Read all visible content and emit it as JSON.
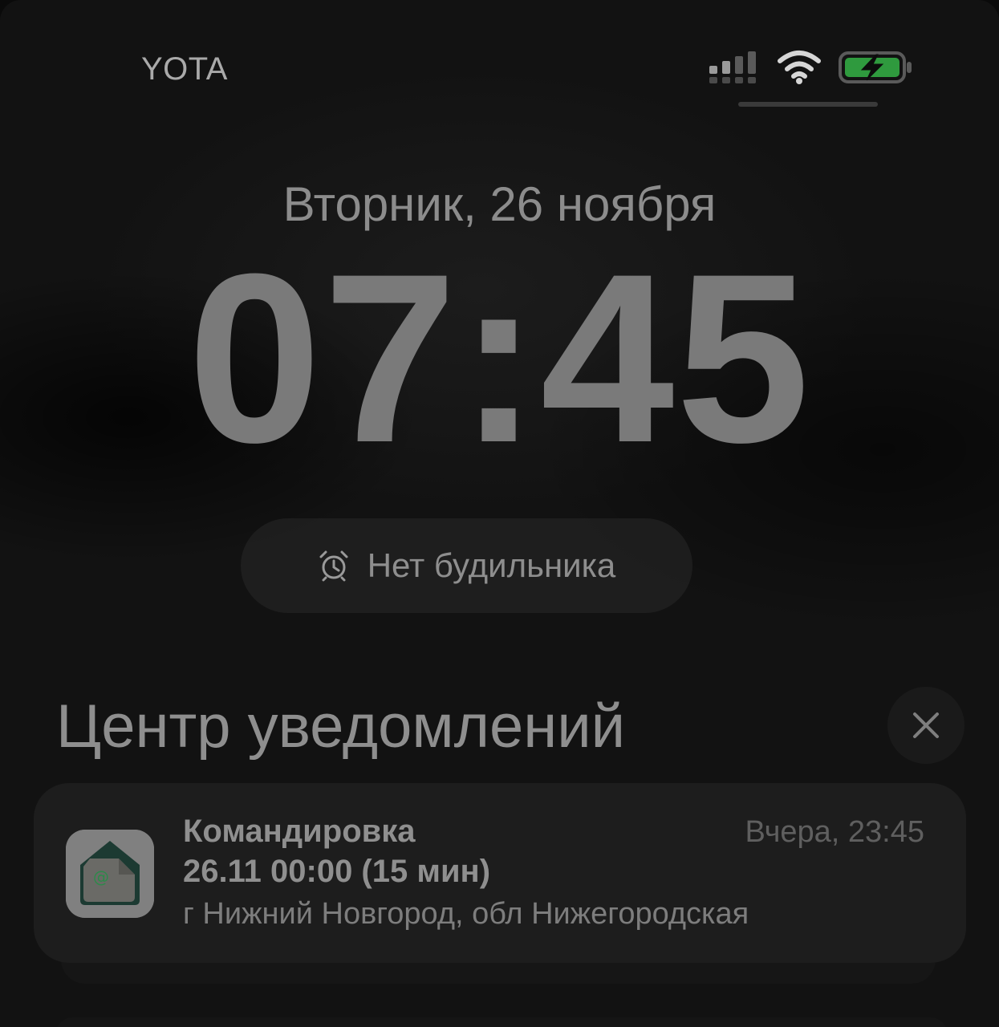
{
  "status_bar": {
    "carrier": "YOTA",
    "icons": [
      "cellular-signal-icon",
      "wifi-icon",
      "battery-charging-icon"
    ],
    "battery_color": "#2f9a3e"
  },
  "lock_screen": {
    "date": "Вторник, 26 ноября",
    "time": "07:45",
    "alarm": {
      "icon": "alarm-clock-icon",
      "label": "Нет будильника"
    }
  },
  "notification_center": {
    "title": "Центр уведомлений",
    "close_icon": "close-icon",
    "notifications": [
      {
        "app_icon": "mail-app-icon",
        "title": "Командировка",
        "time": "Вчера, 23:45",
        "line1": "26.11 00:00 (15 мин)",
        "line2": "г Нижний Новгород, обл Нижегородская"
      }
    ]
  }
}
